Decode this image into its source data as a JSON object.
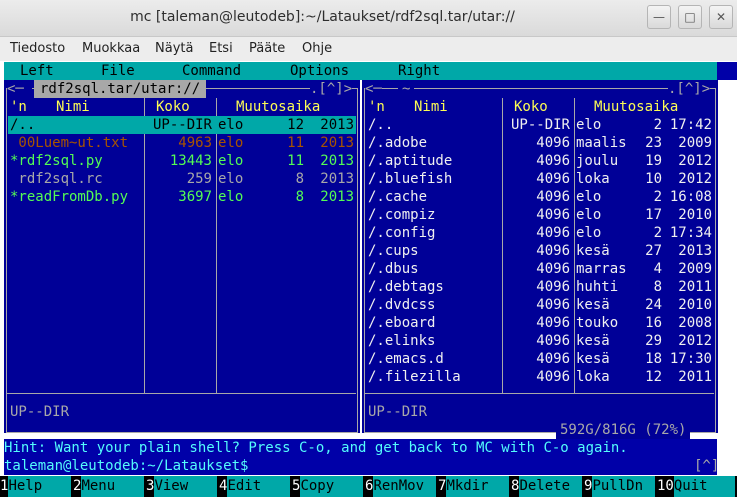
{
  "window": {
    "title": "mc [taleman@leutodeb]:~/Lataukset/rdf2sql.tar/utar://"
  },
  "gnome_menu": [
    "Tiedosto",
    "Muokkaa",
    "Näytä",
    "Etsi",
    "Pääte",
    "Ohje"
  ],
  "mc_menu": [
    "Left",
    "File",
    "Command",
    "Options",
    "Right"
  ],
  "left_panel": {
    "path": "rdf2sql.tar/utar://",
    "frame_left": "<─ ",
    "frame_right": ".[^]>",
    "sort": "'n",
    "col_name": "Nimi",
    "col_size": "Koko",
    "col_time": "Muutosaika",
    "rows": [
      {
        "name": "/..",
        "size": "UP--DIR",
        "month": "elo",
        "day": "12",
        "time": "2013"
      },
      {
        "name": " 00Luem~ut.txt",
        "size": "4963",
        "month": "elo",
        "day": "11",
        "time": "2013"
      },
      {
        "name": "*rdf2sql.py",
        "size": "13443",
        "month": "elo",
        "day": "11",
        "time": "2013"
      },
      {
        "name": " rdf2sql.rc",
        "size": "259",
        "month": "elo",
        "day": "8",
        "time": "2013"
      },
      {
        "name": "*readFromDb.py",
        "size": "3697",
        "month": "elo",
        "day": "8",
        "time": "2013"
      }
    ],
    "status": "UP--DIR"
  },
  "right_panel": {
    "path": "~",
    "frame_left": "<─",
    "frame_right": ".[^]>",
    "sort": "'n",
    "col_name": "Nimi",
    "col_size": "Koko",
    "col_time": "Muutosaika",
    "rows": [
      {
        "name": "/..",
        "size": "UP--DIR",
        "month": "elo",
        "day": "2",
        "time": "17:42"
      },
      {
        "name": "/.adobe",
        "size": "4096",
        "month": "maalis",
        "day": "23",
        "time": "2009"
      },
      {
        "name": "/.aptitude",
        "size": "4096",
        "month": "joulu",
        "day": "19",
        "time": "2012"
      },
      {
        "name": "/.bluefish",
        "size": "4096",
        "month": "loka",
        "day": "10",
        "time": "2012"
      },
      {
        "name": "/.cache",
        "size": "4096",
        "month": "elo",
        "day": "2",
        "time": "16:08"
      },
      {
        "name": "/.compiz",
        "size": "4096",
        "month": "elo",
        "day": "17",
        "time": "2010"
      },
      {
        "name": "/.config",
        "size": "4096",
        "month": "elo",
        "day": "2",
        "time": "17:34"
      },
      {
        "name": "/.cups",
        "size": "4096",
        "month": "kesä",
        "day": "27",
        "time": "2013"
      },
      {
        "name": "/.dbus",
        "size": "4096",
        "month": "marras",
        "day": "4",
        "time": "2009"
      },
      {
        "name": "/.debtags",
        "size": "4096",
        "month": "huhti",
        "day": "8",
        "time": "2011"
      },
      {
        "name": "/.dvdcss",
        "size": "4096",
        "month": "kesä",
        "day": "24",
        "time": "2010"
      },
      {
        "name": "/.eboard",
        "size": "4096",
        "month": "touko",
        "day": "16",
        "time": "2008"
      },
      {
        "name": "/.elinks",
        "size": "4096",
        "month": "kesä",
        "day": "29",
        "time": "2012"
      },
      {
        "name": "/.emacs.d",
        "size": "4096",
        "month": "kesä",
        "day": "18",
        "time": "17:30"
      },
      {
        "name": "/.filezilla",
        "size": "4096",
        "month": "loka",
        "day": "12",
        "time": "2011"
      }
    ],
    "status": "UP--DIR",
    "disk": "592G/816G (72%)"
  },
  "hint": "Hint: Want your plain shell? Press C-o, and get back to MC with C-o again.",
  "prompt": "taleman@leutodeb:~/Lataukset$",
  "prompt_scroll": "[^]",
  "fkeys": [
    {
      "n": "1",
      "label": "Help"
    },
    {
      "n": "2",
      "label": "Menu"
    },
    {
      "n": "3",
      "label": "View"
    },
    {
      "n": "4",
      "label": "Edit"
    },
    {
      "n": "5",
      "label": "Copy"
    },
    {
      "n": "6",
      "label": "RenMov"
    },
    {
      "n": "7",
      "label": "Mkdir"
    },
    {
      "n": "8",
      "label": "Delete"
    },
    {
      "n": "9",
      "label": "PullDn"
    },
    {
      "n": "10",
      "label": "Quit"
    }
  ],
  "colors": {
    "panel_bg": "#000097",
    "selection": "#00a8a8",
    "executable": "#54fc54",
    "header": "#fcfc54"
  }
}
